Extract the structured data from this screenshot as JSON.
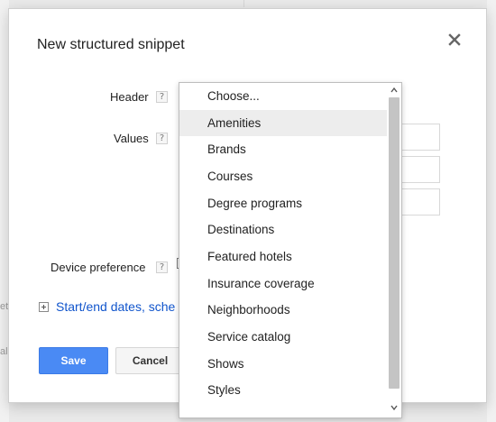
{
  "background": {
    "line1": "et",
    "line2": "al"
  },
  "dialog": {
    "title": "New structured snippet",
    "header_label": "Header",
    "values_label": "Values",
    "device_label": "Device preference",
    "help_glyph": "?",
    "expand_link": "Start/end dates, sche",
    "save_label": "Save",
    "cancel_label": "Cancel"
  },
  "dropdown": {
    "options": [
      "Choose...",
      "Amenities",
      "Brands",
      "Courses",
      "Degree programs",
      "Destinations",
      "Featured hotels",
      "Insurance coverage",
      "Neighborhoods",
      "Service catalog",
      "Shows",
      "Styles"
    ],
    "highlighted": "Amenities"
  },
  "colors": {
    "accent": "#4a8af4",
    "link": "#1155cc",
    "highlight": "#ededed"
  }
}
